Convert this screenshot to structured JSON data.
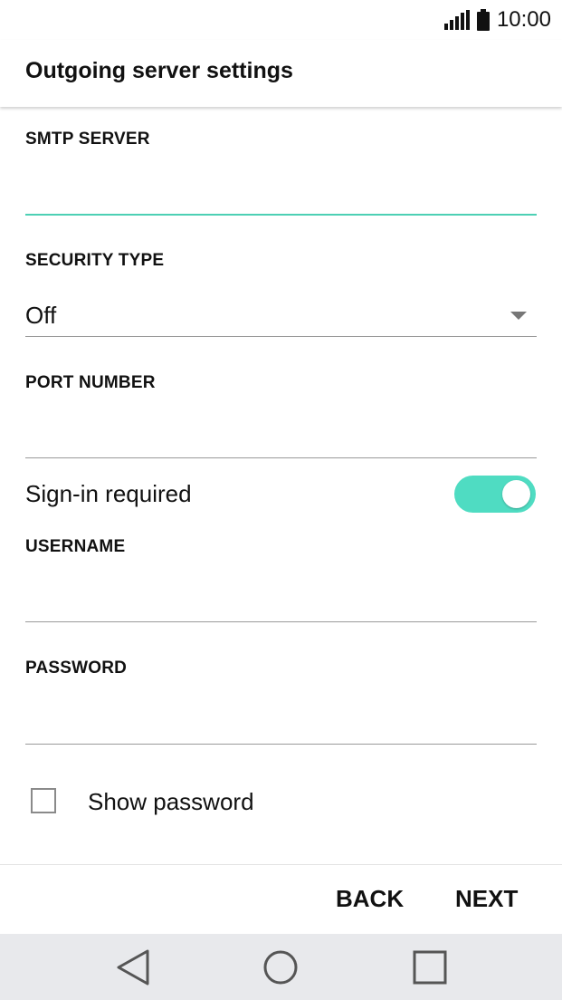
{
  "status_bar": {
    "time": "10:00",
    "icons": [
      "signal-icon",
      "battery-icon"
    ]
  },
  "app_bar": {
    "title": "Outgoing server settings"
  },
  "form": {
    "smtp_server": {
      "label": "SMTP SERVER",
      "value": ""
    },
    "security_type": {
      "label": "SECURITY TYPE",
      "value": "Off"
    },
    "port_number": {
      "label": "PORT NUMBER",
      "value": ""
    },
    "sign_in_required": {
      "label": "Sign-in required",
      "checked": true
    },
    "username": {
      "label": "USERNAME",
      "value": ""
    },
    "password": {
      "label": "PASSWORD",
      "value": ""
    },
    "show_password": {
      "label": "Show password",
      "checked": false
    }
  },
  "actions": {
    "back_label": "BACK",
    "next_label": "NEXT"
  },
  "colors": {
    "accent": "#4dd0b4",
    "toggle_on": "#4fdcc2",
    "nav_bar": "#e8e9ec"
  },
  "nav_bar": {
    "icons": [
      "back-triangle-icon",
      "home-circle-icon",
      "recents-square-icon"
    ]
  }
}
